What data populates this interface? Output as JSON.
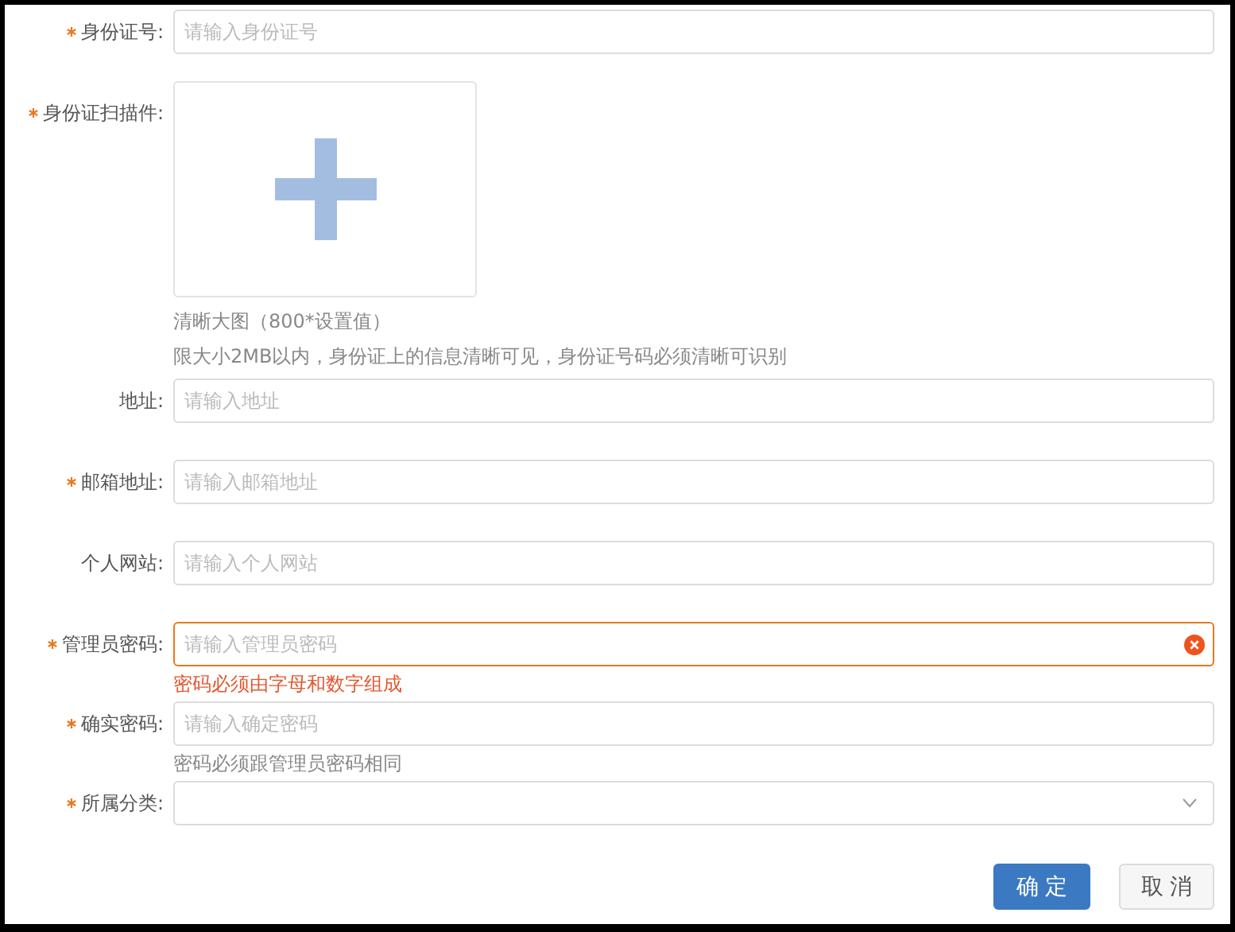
{
  "fields": [
    {
      "kind": "text",
      "label": "身份证号:",
      "required": true,
      "placeholder": "请输入身份证号",
      "error": false
    },
    {
      "kind": "upload",
      "label": "身份证扫描件:",
      "required": true,
      "error": false,
      "hints": [
        {
          "text": "清晰大图（800*设置值）",
          "error": false
        },
        {
          "text": "限大小2MB以内，身份证上的信息清晰可见，身份证号码必须清晰可识别",
          "error": false
        }
      ]
    },
    {
      "kind": "text",
      "label": "地址:",
      "required": false,
      "placeholder": "请输入地址",
      "error": false
    },
    {
      "kind": "text",
      "label": "邮箱地址:",
      "required": true,
      "placeholder": "请输入邮箱地址",
      "error": false
    },
    {
      "kind": "text",
      "label": "个人网站:",
      "required": false,
      "placeholder": "请输入个人网站",
      "error": false
    },
    {
      "kind": "text",
      "label": "管理员密码:",
      "required": true,
      "placeholder": "请输入管理员密码",
      "error": true,
      "hints": [
        {
          "text": "密码必须由字母和数字组成",
          "error": true
        }
      ]
    },
    {
      "kind": "text",
      "label": "确实密码:",
      "required": true,
      "placeholder": "请输入确定密码",
      "error": false,
      "hints": [
        {
          "text": "密码必须跟管理员密码相同",
          "error": false
        }
      ]
    },
    {
      "kind": "select",
      "label": "所属分类:",
      "required": true,
      "error": false
    }
  ],
  "buttons": [
    {
      "label": "确定",
      "primary": true
    },
    {
      "label": "取消",
      "primary": false
    }
  ]
}
